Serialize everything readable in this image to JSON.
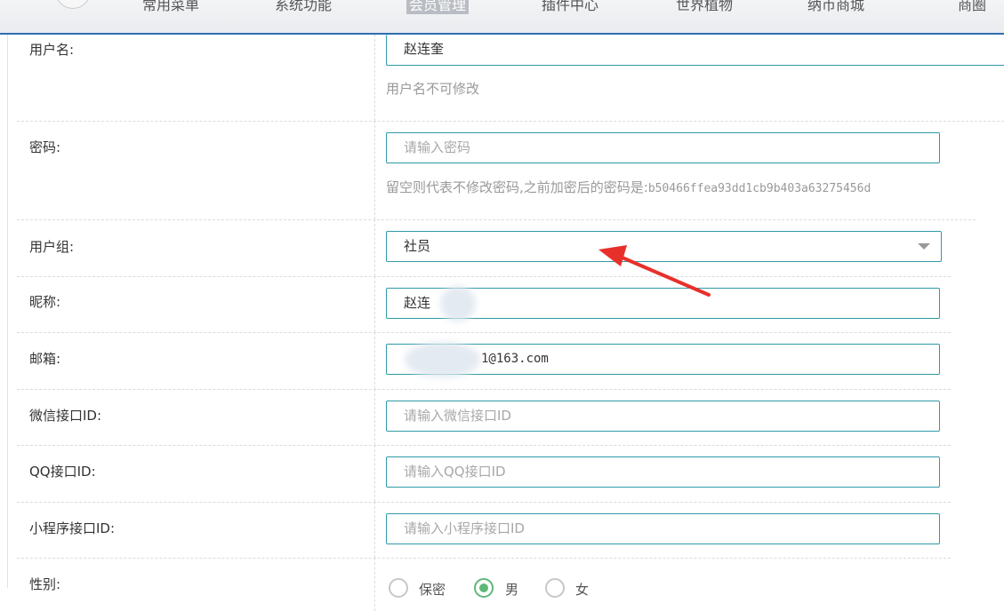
{
  "nav": {
    "items": [
      "常用菜单",
      "系统功能",
      "会员管理",
      "插件中心",
      "世界植物",
      "纳币商城",
      "商圈"
    ]
  },
  "form": {
    "username": {
      "label": "用户名:",
      "value": "赵连奎",
      "hint": "用户名不可修改"
    },
    "password": {
      "label": "密码:",
      "placeholder": "请输入密码",
      "hint_text": "留空则代表不修改密码,之前加密后的密码是:",
      "hint_hash": "b50466ffea93dd1cb9b403a63275456d"
    },
    "group": {
      "label": "用户组:",
      "value": "社员"
    },
    "nickname": {
      "label": "昵称:",
      "value": "赵连"
    },
    "email": {
      "label": "邮箱:",
      "value": "1@163.com"
    },
    "wechat": {
      "label": "微信接口ID:",
      "placeholder": "请输入微信接口ID"
    },
    "qq": {
      "label": "QQ接口ID:",
      "placeholder": "请输入QQ接口ID"
    },
    "miniprogram": {
      "label": "小程序接口ID:",
      "placeholder": "请输入小程序接口ID"
    },
    "gender": {
      "label": "性别:",
      "options": [
        "保密",
        "男",
        "女"
      ],
      "selected": "男"
    }
  },
  "colors": {
    "accent": "#2e9aa8",
    "nav_border": "#2d6fb0",
    "annotation_arrow": "#e8302a",
    "radio_checked": "#5fb878"
  }
}
